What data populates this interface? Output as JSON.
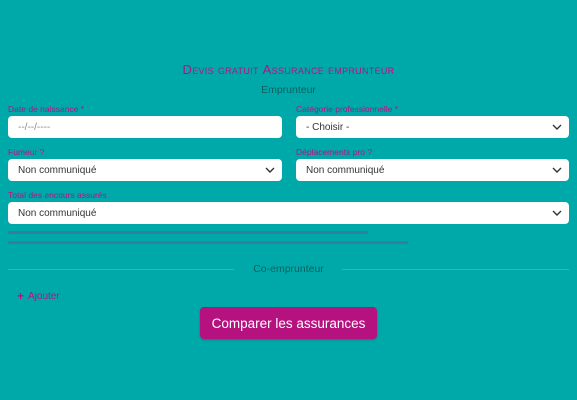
{
  "form": {
    "title_prefix_D": "D",
    "title_rest_1": "evis gratuit ",
    "title_prefix_A": "A",
    "title_rest_2": "ssurance emprunteur",
    "section_borrower": "Emprunteur",
    "section_coborrower": "Co-emprunteur",
    "fields": {
      "birth_date": {
        "label": "Date de naissance *",
        "placeholder": "--/--/----"
      },
      "category": {
        "label": "Catégorie professionnelle *",
        "value": "- Choisir -"
      },
      "smoker": {
        "label": "Fumeur ?",
        "value": "Non communiqué"
      },
      "travel": {
        "label": "Déplacements pro ?",
        "value": "Non communiqué"
      },
      "total": {
        "label": "Total des encours assurés",
        "value": "Non communiqué"
      }
    },
    "add_label": "Ajouter",
    "submit_label": "Comparer les assurances"
  },
  "colors": {
    "background": "#00a9a9",
    "accent": "#b5127f",
    "field_bg": "#ffffff"
  },
  "icons": [
    "chevron-down-icon",
    "plus-icon"
  ]
}
